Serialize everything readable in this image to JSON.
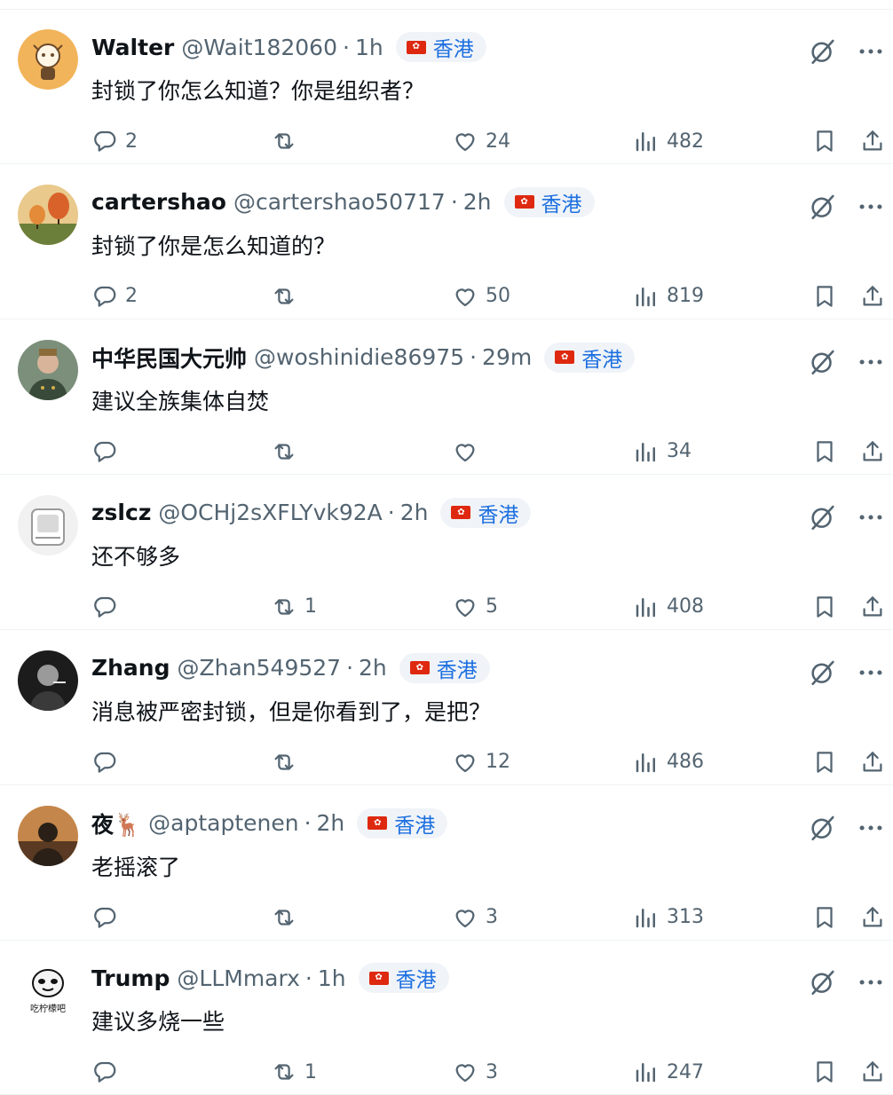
{
  "location_label": "香港",
  "replies": [
    {
      "name": "Walter",
      "handle": "@Wait182060",
      "time": "1h",
      "text": "封锁了你怎么知道？你是组织者？",
      "reply_count": "2",
      "retweet_count": "",
      "like_count": "24",
      "view_count": "482",
      "avatar": {
        "bg": "#f2b45a",
        "fg": "#6b4a2b",
        "kind": "cartoon"
      }
    },
    {
      "name": "cartershao",
      "handle": "@cartershao50717",
      "time": "2h",
      "text": "封锁了你是怎么知道的？",
      "reply_count": "2",
      "retweet_count": "",
      "like_count": "50",
      "view_count": "819",
      "avatar": {
        "bg": "#c9a66b",
        "fg": "#d9622b",
        "kind": "balloons"
      }
    },
    {
      "name": "中华民国大元帅",
      "handle": "@woshinidie86975",
      "time": "29m",
      "text": "建议全族集体自焚",
      "reply_count": "",
      "retweet_count": "",
      "like_count": "",
      "view_count": "34",
      "avatar": {
        "bg": "#7b8f7a",
        "fg": "#3a4a3a",
        "kind": "portrait"
      }
    },
    {
      "name": "zslcz",
      "handle": "@OCHj2sXFLYvk92A",
      "time": "2h",
      "text": "还不够多",
      "reply_count": "",
      "retweet_count": "1",
      "like_count": "5",
      "view_count": "408",
      "avatar": {
        "bg": "#f1f1f1",
        "fg": "#9a9a9a",
        "kind": "object"
      }
    },
    {
      "name": "Zhang",
      "handle": "@Zhan549527",
      "time": "2h",
      "text": "消息被严密封锁，但是你看到了，是把？",
      "reply_count": "",
      "retweet_count": "",
      "like_count": "12",
      "view_count": "486",
      "avatar": {
        "bg": "#1c1c1c",
        "fg": "#e8e8e8",
        "kind": "dark"
      }
    },
    {
      "name": "夜🦌",
      "handle": "@aptaptenen",
      "time": "2h",
      "text": "老摇滚了",
      "reply_count": "",
      "retweet_count": "",
      "like_count": "3",
      "view_count": "313",
      "avatar": {
        "bg": "#c4864a",
        "fg": "#2a2018",
        "kind": "sunset"
      }
    },
    {
      "name": "Trump",
      "handle": "@LLMmarx",
      "time": "1h",
      "text": "建议多烧一些",
      "reply_count": "",
      "retweet_count": "1",
      "like_count": "3",
      "view_count": "247",
      "avatar": {
        "bg": "#ffffff",
        "fg": "#111111",
        "kind": "meme",
        "caption": "吃柠檬吧"
      }
    }
  ],
  "colors": {
    "text": "#0f1419",
    "secondary": "#536471",
    "location": "#1d6fe0",
    "divider": "#eff3f4",
    "flag": "#de2910"
  },
  "icons": [
    "reply-icon",
    "retweet-icon",
    "like-icon",
    "views-icon",
    "bookmark-icon",
    "share-icon",
    "grok-icon",
    "more-icon",
    "hk-flag-icon"
  ]
}
